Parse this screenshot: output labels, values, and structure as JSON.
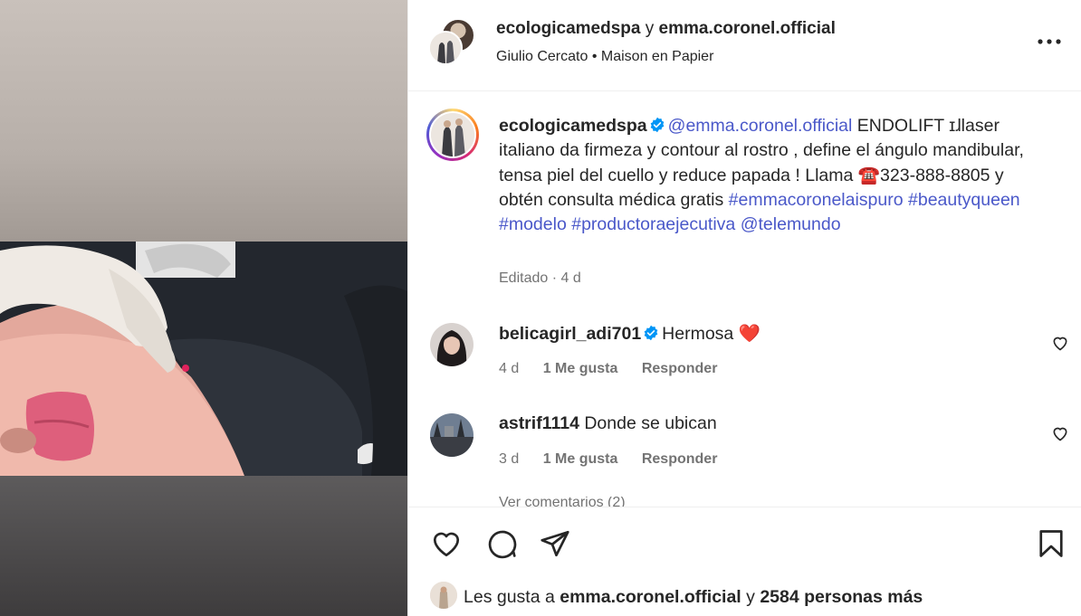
{
  "post": {
    "header": {
      "author1": "ecologicamedspa",
      "joiner": "y",
      "author2": "emma.coronel.official",
      "audio_artist": "Giulio Cercato",
      "dot": "•",
      "audio_title": "Maison en Papier"
    },
    "caption": {
      "username": "ecologicamedspa",
      "mention": "@emma.coronel.official",
      "text_1": " ENDOLIFT ɪɺlaser italiano da firmeza y contour al rostro , define el ángulo mandibular, tensa piel del cuello y reduce papada ! Llama ",
      "phone_emoji": "☎️",
      "text_2": "323-888-8805 y obtén consulta médica gratis ",
      "hashtag_1": "#emmacoronelaispuro",
      "hashtag_2": "#beautyqueen",
      "hashtag_3": "#modelo",
      "hashtag_4": "#productoraejecutiva",
      "mention_2": "@telemundo",
      "meta": "Editado · 4 d"
    },
    "comments": [
      {
        "username": "belicagirl_adi701",
        "verified": true,
        "text": "Hermosa",
        "emoji": "❤️",
        "time": "4 d",
        "likes": "1 Me gusta",
        "reply": "Responder"
      },
      {
        "username": "astrif1114",
        "verified": false,
        "text": "Donde se ubican",
        "time": "3 d",
        "likes": "1 Me gusta",
        "reply": "Responder"
      }
    ],
    "view_more": "Ver comentarios (2)",
    "likes": {
      "prefix": "Les gusta a",
      "user": "emma.coronel.official",
      "joiner": "y",
      "count": "2584 personas más"
    }
  },
  "colors": {
    "link": "#4a58c9",
    "verified": "#0095f6",
    "heart": "#ed4956",
    "muted": "#737373"
  },
  "icons": {
    "more": "more-options-icon",
    "like": "heart-icon",
    "comment": "comment-icon",
    "share": "share-icon",
    "save": "bookmark-icon",
    "verified": "verified-badge-icon"
  }
}
